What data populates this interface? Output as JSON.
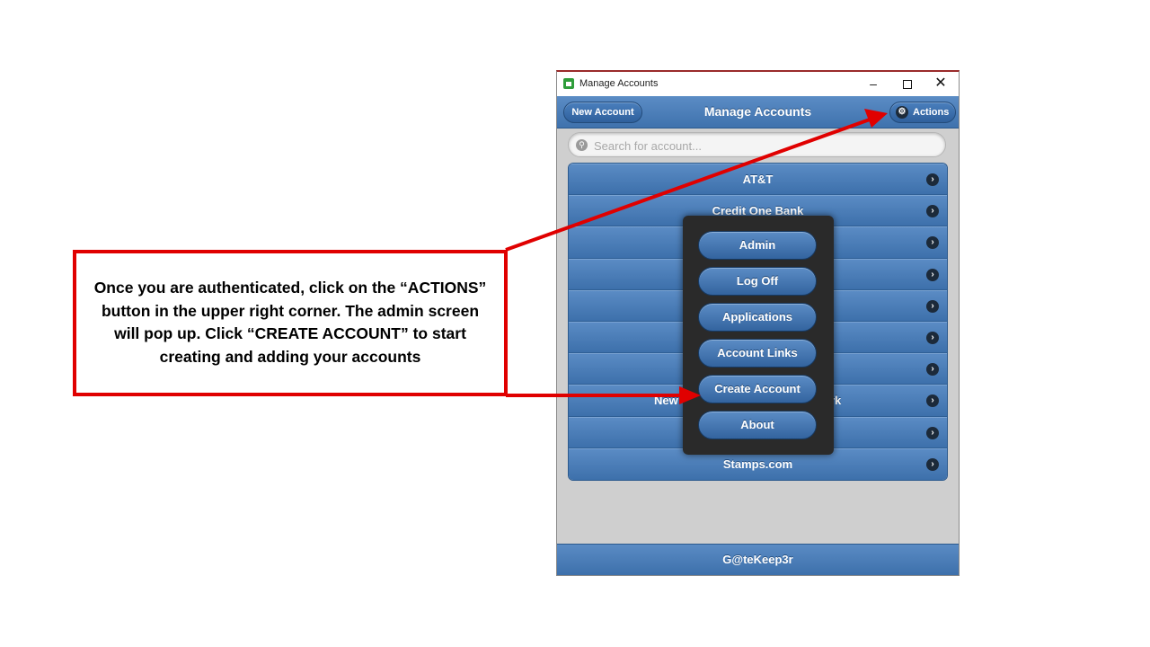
{
  "window": {
    "title": "Manage Accounts",
    "controls": {
      "minimize": "–",
      "close": "✕"
    }
  },
  "header": {
    "new_account_label": "New Account",
    "title": "Manage Accounts",
    "actions_label": "Actions",
    "actions_icon": "gear-icon"
  },
  "search": {
    "placeholder": "Search for account..."
  },
  "accounts": [
    {
      "label": "AT&T"
    },
    {
      "label": "Credit One Bank"
    },
    {
      "label": ""
    },
    {
      "label": ""
    },
    {
      "label": ""
    },
    {
      "label": ""
    },
    {
      "label": ""
    },
    {
      "label_left": "New",
      "label_right": "rk"
    },
    {
      "label": ""
    },
    {
      "label": "Stamps.com"
    }
  ],
  "popup": {
    "items": [
      "Admin",
      "Log Off",
      "Applications",
      "Account Links",
      "Create Account",
      "About"
    ]
  },
  "footer": {
    "label": "G@teKeep3r"
  },
  "callout": {
    "lines": [
      "Once you are authenticated, click on the “ACTIONS”",
      "button in the upper right corner. The admin screen",
      "will pop up. Click “CREATE ACCOUNT” to start",
      "creating and adding your accounts"
    ]
  },
  "colors": {
    "accent": "#4a7fbd",
    "arrow": "#e00000",
    "popup_bg": "#2a2a2a"
  }
}
